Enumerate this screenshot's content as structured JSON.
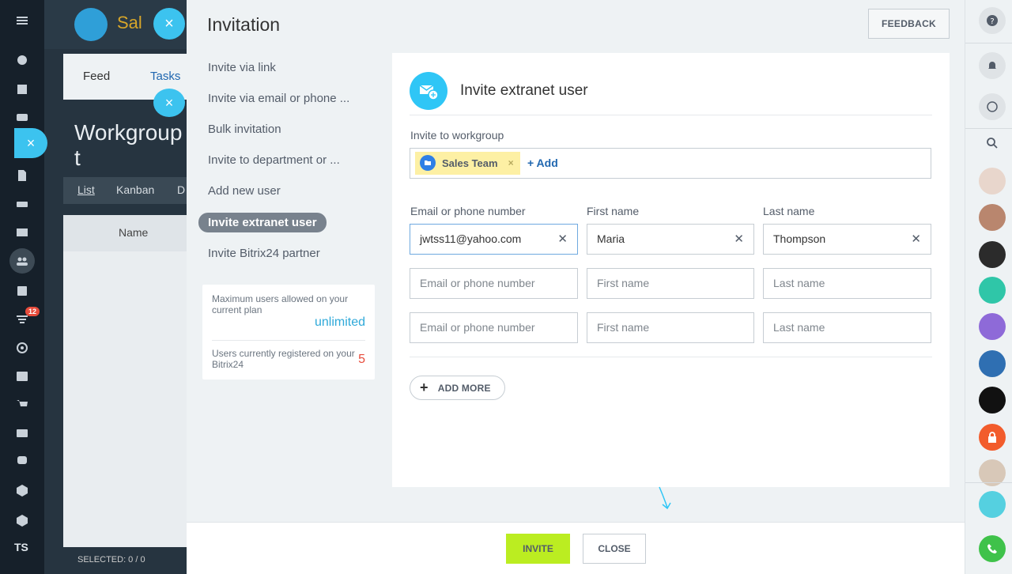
{
  "panel": {
    "title": "Invitation",
    "feedback_label": "FEEDBACK"
  },
  "menu": {
    "items": [
      {
        "label": "Invite via link"
      },
      {
        "label": "Invite via email or phone ..."
      },
      {
        "label": "Bulk invitation"
      },
      {
        "label": "Invite to department or ..."
      },
      {
        "label": "Add new user"
      },
      {
        "label": "Invite extranet user"
      },
      {
        "label": "Invite Bitrix24 partner"
      }
    ],
    "active_index": 5
  },
  "plan_info": {
    "max_users_label": "Maximum users allowed on your current plan",
    "max_users_value": "unlimited",
    "registered_label": "Users currently registered on your Bitrix24",
    "registered_value": "5"
  },
  "card": {
    "title": "Invite extranet user",
    "workgroup_label": "Invite to workgroup",
    "workgroup_tag": "Sales Team",
    "workgroup_add": "+ Add",
    "columns": {
      "email": "Email or phone number",
      "first_name": "First name",
      "last_name": "Last name"
    },
    "rows": [
      {
        "email": "jwtss11@yahoo.com",
        "first": "Maria",
        "last": "Thompson"
      },
      {
        "email": "",
        "first": "",
        "last": ""
      },
      {
        "email": "",
        "first": "",
        "last": ""
      }
    ],
    "placeholders": {
      "email": "Email or phone number",
      "first": "First name",
      "last": "Last name"
    },
    "add_more_label": "ADD MORE"
  },
  "footer": {
    "invite_label": "INVITE",
    "close_label": "CLOSE"
  },
  "background": {
    "logo_text": "Sal",
    "tabs": [
      "Feed",
      "Tasks"
    ],
    "title": "Workgroup t",
    "views": [
      "List",
      "Kanban",
      "D"
    ],
    "column_name": "Name",
    "selected": "SELECTED: 0 / 0",
    "counter_badge": "12",
    "ts_label": "TS"
  },
  "colors": {
    "accent": "#2fc6f6",
    "invite_button": "#bbed21",
    "link": "#2067b0",
    "unlimited": "#2fa9d9",
    "registered": "#e74c3c"
  }
}
